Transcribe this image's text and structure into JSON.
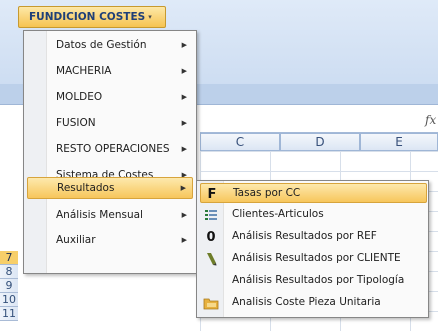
{
  "ribbon": {
    "addin_button": {
      "label": "FUNDICION COSTES",
      "arrow": "▾"
    },
    "formula_icon": "fx"
  },
  "columns": [
    "C",
    "D",
    "E"
  ],
  "rows": [
    "7",
    "8",
    "9",
    "10",
    "11"
  ],
  "selected_row": "7",
  "main_menu": {
    "items": [
      {
        "label": "Datos de Gestión",
        "submenu": true
      },
      {
        "label": "MACHERIA",
        "submenu": true
      },
      {
        "label": "MOLDEO",
        "submenu": true
      },
      {
        "label": "FUSION",
        "submenu": true
      },
      {
        "label": "RESTO OPERACIONES",
        "submenu": true
      },
      {
        "label": "Sistema de Costes",
        "submenu": true
      },
      {
        "label": "Resultados",
        "submenu": true,
        "highlighted": true
      },
      {
        "label": "Análisis Mensual",
        "submenu": true
      },
      {
        "label": "Auxiliar",
        "submenu": true
      }
    ],
    "chevron": "▶"
  },
  "submenu": {
    "items": [
      {
        "label": "Tasas por CC",
        "icon": "F",
        "icon_name": "bold-f-icon",
        "highlighted": true
      },
      {
        "label": "Clientes-Articulos",
        "icon": "",
        "icon_name": "list-icon"
      },
      {
        "label": "Análisis Resultados por REF",
        "icon": "0",
        "icon_name": "zero-icon"
      },
      {
        "label": "Análisis Resultados por CLIENTE",
        "icon": "",
        "icon_name": "pencil-icon"
      },
      {
        "label": "Análisis Resultados por Tipología",
        "icon": "",
        "icon_name": "none"
      },
      {
        "label": "Analisis Coste Pieza Unitaria",
        "icon": "",
        "icon_name": "folder-icon"
      }
    ]
  },
  "colors": {
    "highlight": "#f7c65c",
    "accent": "#1e3f78"
  }
}
